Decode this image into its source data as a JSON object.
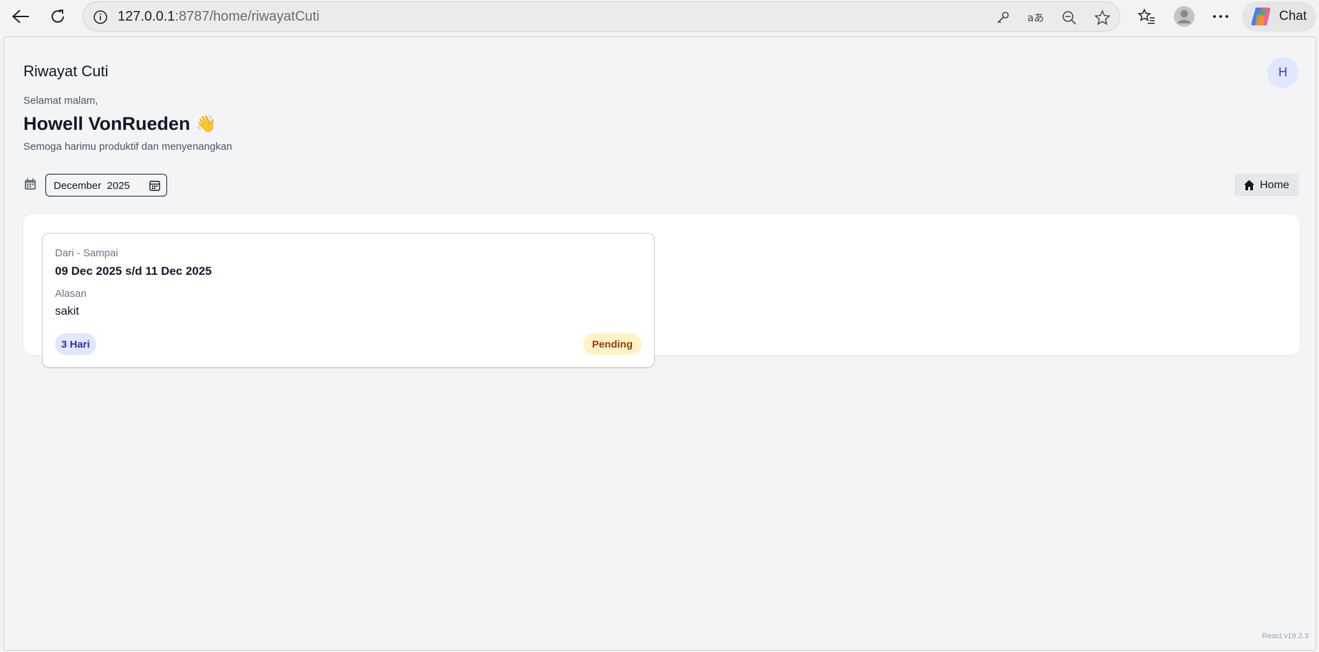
{
  "browser": {
    "url_host": "127.0.0.1",
    "url_rest": ":8787/home/riwayatCuti",
    "chat_label": "Chat"
  },
  "page": {
    "title": "Riwayat Cuti",
    "avatar_initial": "H",
    "greeting": "Selamat malam,",
    "user_name": "Howell VonRueden",
    "wave_emoji": "👋",
    "subtext": "Semoga harimu produktif dan menyenangkan",
    "month_value": "December  2025",
    "home_label": "Home",
    "version": "React v19.2.3"
  },
  "leave_card": {
    "range_label": "Dari - Sampai",
    "range_value": "09 Dec 2025 s/d 11 Dec 2025",
    "reason_label": "Alasan",
    "reason_value": "sakit",
    "days": "3 Hari",
    "status": "Pending"
  },
  "colors": {
    "accent": "#4338ca",
    "pending_bg": "#fef3c7",
    "days_bg": "#e0e7ff"
  }
}
